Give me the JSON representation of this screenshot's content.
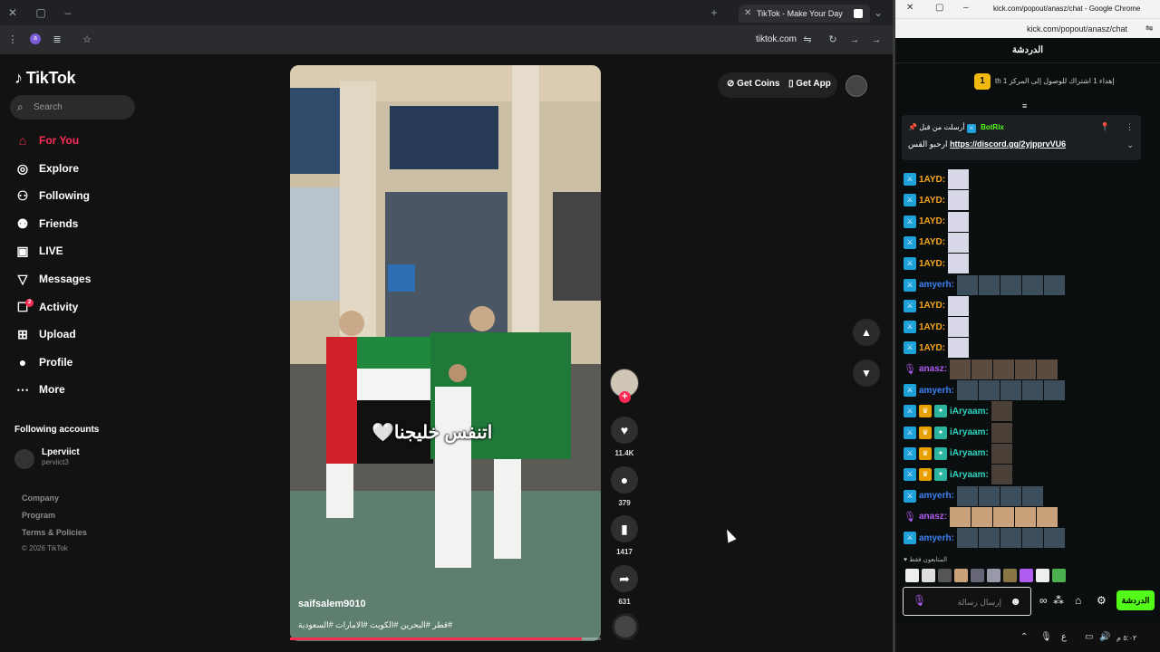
{
  "left_window": {
    "tab": {
      "title": "TikTok - Make Your Day"
    },
    "address_bar": {
      "url": "tiktok.com"
    }
  },
  "tiktok": {
    "logo": "TikTok",
    "search": {
      "placeholder": "Search"
    },
    "nav": [
      {
        "label": "For You",
        "icon": "home-icon",
        "active": true
      },
      {
        "label": "Explore",
        "icon": "compass-icon"
      },
      {
        "label": "Following",
        "icon": "following-icon"
      },
      {
        "label": "Friends",
        "icon": "friends-icon"
      },
      {
        "label": "LIVE",
        "icon": "live-icon"
      },
      {
        "label": "Messages",
        "icon": "messages-icon"
      },
      {
        "label": "Activity",
        "icon": "activity-icon",
        "badge": "2"
      },
      {
        "label": "Upload",
        "icon": "upload-icon"
      },
      {
        "label": "Profile",
        "icon": "profile-icon"
      },
      {
        "label": "More",
        "icon": "more-icon"
      }
    ],
    "following_accounts_label": "Following accounts",
    "following_accounts": [
      {
        "name": "Lperviict",
        "handle": "perviict3"
      }
    ],
    "footer": {
      "links": [
        "Company",
        "Program",
        "Terms & Policies"
      ],
      "copyright": "© 2026 TikTok"
    },
    "top_buttons": {
      "coins": "Get Coins",
      "app": "Get App"
    },
    "video": {
      "caption_overlay": "اتنفس خليجنا🤍",
      "author": "saifsalem9010",
      "hashtags": "#قطر #البحرين #الكويت #الامارات #السعودية",
      "progress": 0.94
    },
    "actions": {
      "likes": "11.4K",
      "comments": "379",
      "saves": "1417",
      "shares": "631"
    }
  },
  "right_window": {
    "title": "kick.com/popout/anasz/chat - Google Chrome",
    "url": "kick.com/popout/anasz/chat",
    "chat_header": "الدردشة",
    "goal": {
      "number": "1",
      "text": "th إهداء 1 اشتراك للوصول إلى المركز 1"
    },
    "pinned": {
      "from": "أرسلت من قبل",
      "bot": "BotRix",
      "prefix": "ارحبو القس",
      "link": "https://discord.gg/2yjpprvVU6"
    },
    "messages": [
      {
        "user": "1AYD",
        "color": "#f7a61b",
        "badges": [
          "mod"
        ],
        "emotes": 1,
        "emote_color": "#d8d8e8"
      },
      {
        "user": "1AYD",
        "color": "#f7a61b",
        "badges": [
          "mod"
        ],
        "emotes": 1,
        "emote_color": "#d8d8e8"
      },
      {
        "user": "1AYD",
        "color": "#f7a61b",
        "badges": [
          "mod"
        ],
        "emotes": 1,
        "emote_color": "#d8d8e8"
      },
      {
        "user": "1AYD",
        "color": "#f7a61b",
        "badges": [
          "mod"
        ],
        "emotes": 1,
        "emote_color": "#d8d8e8"
      },
      {
        "user": "1AYD",
        "color": "#f7a61b",
        "badges": [
          "mod"
        ],
        "emotes": 1,
        "emote_color": "#d8d8e8"
      },
      {
        "user": "amyerh",
        "color": "#3b82f6",
        "badges": [
          "mod"
        ],
        "emotes": 5,
        "emote_color": "#3c4e5c"
      },
      {
        "user": "1AYD",
        "color": "#f7a61b",
        "badges": [
          "mod"
        ],
        "emotes": 1,
        "emote_color": "#d8d8e8"
      },
      {
        "user": "1AYD",
        "color": "#f7a61b",
        "badges": [
          "mod"
        ],
        "emotes": 1,
        "emote_color": "#d8d8e8"
      },
      {
        "user": "1AYD",
        "color": "#f7a61b",
        "badges": [
          "mod"
        ],
        "emotes": 1,
        "emote_color": "#d8d8e8"
      },
      {
        "user": "anasz",
        "color": "#b15cf0",
        "badges": [
          "mic"
        ],
        "emotes": 5,
        "emote_color": "#5b4a3e"
      },
      {
        "user": "amyerh",
        "color": "#3b82f6",
        "badges": [
          "mod"
        ],
        "emotes": 5,
        "emote_color": "#3c4e5c"
      },
      {
        "user": "iAryaam",
        "color": "#2dd4bf",
        "badges": [
          "mod",
          "vip",
          "sub"
        ],
        "emotes": 1,
        "emote_color": "#4a4038"
      },
      {
        "user": "iAryaam",
        "color": "#2dd4bf",
        "badges": [
          "mod",
          "vip",
          "sub"
        ],
        "emotes": 1,
        "emote_color": "#4a4038"
      },
      {
        "user": "iAryaam",
        "color": "#2dd4bf",
        "badges": [
          "mod",
          "vip",
          "sub"
        ],
        "emotes": 1,
        "emote_color": "#4a4038"
      },
      {
        "user": "iAryaam",
        "color": "#2dd4bf",
        "badges": [
          "mod",
          "vip",
          "sub"
        ],
        "emotes": 1,
        "emote_color": "#4a4038"
      },
      {
        "user": "amyerh",
        "color": "#3b82f6",
        "badges": [
          "mod"
        ],
        "emotes": 4,
        "emote_color": "#3c4e5c"
      },
      {
        "user": "anasz",
        "color": "#b15cf0",
        "badges": [
          "mic"
        ],
        "emotes": 5,
        "emote_color": "#c9a27c"
      },
      {
        "user": "amyerh",
        "color": "#3b82f6",
        "badges": [
          "mod"
        ],
        "emotes": 5,
        "emote_color": "#3c4e5c"
      }
    ],
    "emote_bar_label": "المتابعون فقط",
    "input": {
      "placeholder": "إرسال رسالة"
    },
    "send_label": "الدردشة",
    "clock": "٥:٠٢ م"
  }
}
